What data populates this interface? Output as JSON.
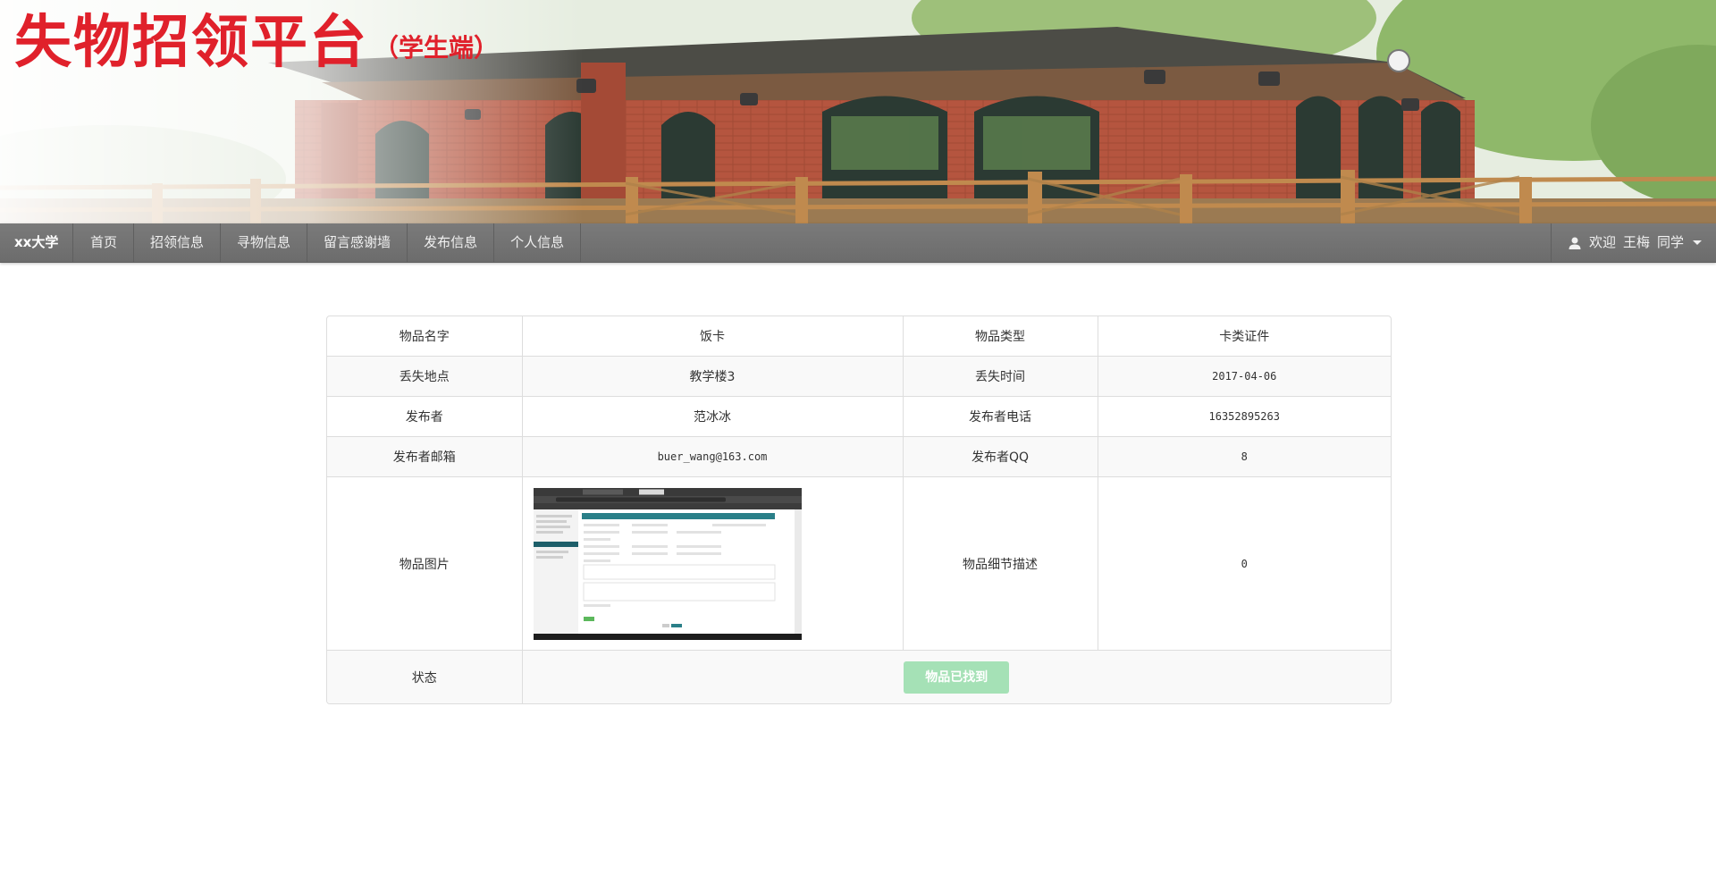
{
  "banner": {
    "title": "失物招领平台",
    "subtitle": "（学生端）"
  },
  "navbar": {
    "brand": "xx大学",
    "items": [
      {
        "label": "首页"
      },
      {
        "label": "招领信息"
      },
      {
        "label": "寻物信息"
      },
      {
        "label": "留言感谢墙"
      },
      {
        "label": "发布信息"
      },
      {
        "label": "个人信息"
      }
    ],
    "user": {
      "greeting": "欢迎",
      "name": "王梅",
      "suffix": "同学",
      "icon": "user-icon"
    }
  },
  "detail": {
    "rows": [
      {
        "label1": "物品名字",
        "value1": "饭卡",
        "label2": "物品类型",
        "value2": "卡类证件"
      },
      {
        "label1": "丢失地点",
        "value1": "教学楼3",
        "label2": "丢失时间",
        "value2": "2017-04-06"
      },
      {
        "label1": "发布者",
        "value1": "范冰冰",
        "label2": "发布者电话",
        "value2": "16352895263"
      },
      {
        "label1": "发布者邮箱",
        "value1": "buer_wang@163.com",
        "label2": "发布者QQ",
        "value2": "8"
      }
    ],
    "image_row": {
      "label": "物品图片",
      "desc_label": "物品细节描述",
      "desc_value": "0"
    },
    "status_row": {
      "label": "状态",
      "button": "物品已找到"
    }
  },
  "colors": {
    "title_red": "#e0212b",
    "navbar_bg": "#737373",
    "status_button": "#a5e1b6"
  }
}
